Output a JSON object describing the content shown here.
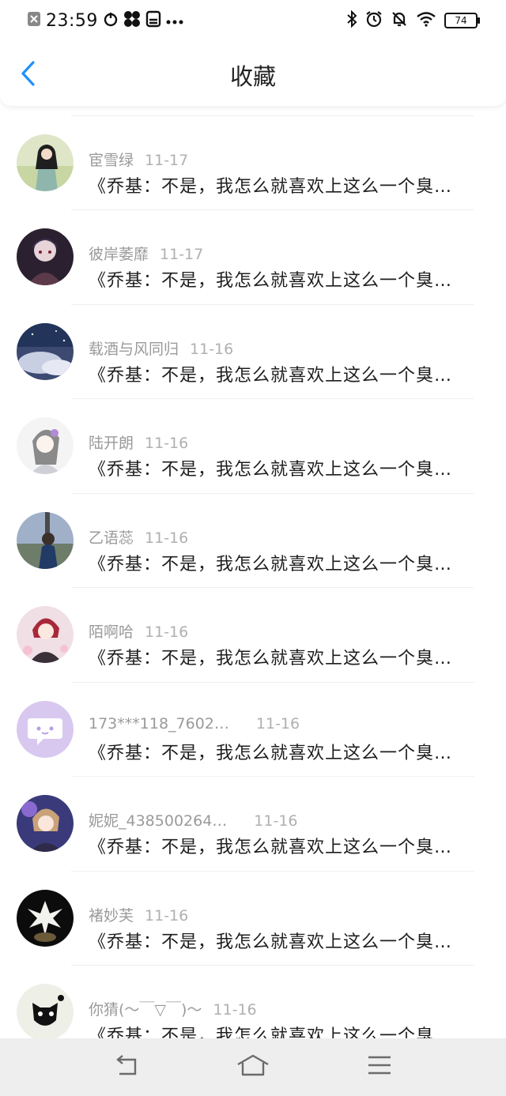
{
  "status_bar": {
    "time": "23:59",
    "battery": "74",
    "icons": [
      "close-box-icon",
      "power-sync-icon",
      "fan-icon",
      "sim-card-icon",
      "more-dots-icon",
      "bluetooth-icon",
      "alarm-icon",
      "mute-bell-icon",
      "wifi-icon",
      "battery-icon"
    ]
  },
  "header": {
    "title": "收藏",
    "back_icon": "chevron-left-icon"
  },
  "colors": {
    "accent": "#1e90ff",
    "text": "#1e1e1e",
    "meta": "#9a9a9a",
    "navbar": "#eeeeef"
  },
  "items": [
    {
      "name": "宦雪绿",
      "date": "11-17",
      "message": "《乔基：不是，我怎么就喜欢上这么一个臭…",
      "avatar": "avatar-photo"
    },
    {
      "name": "彼岸萎靡",
      "date": "11-17",
      "message": "《乔基：不是，我怎么就喜欢上这么一个臭…",
      "avatar": "avatar-photo"
    },
    {
      "name": "载酒与风同归",
      "date": "11-16",
      "message": "《乔基：不是，我怎么就喜欢上这么一个臭…",
      "avatar": "avatar-photo"
    },
    {
      "name": "陆开朗",
      "date": "11-16",
      "message": "《乔基：不是，我怎么就喜欢上这么一个臭…",
      "avatar": "avatar-photo"
    },
    {
      "name": "乙语蕊",
      "date": "11-16",
      "message": "《乔基：不是，我怎么就喜欢上这么一个臭…",
      "avatar": "avatar-photo"
    },
    {
      "name": "陌啊哈",
      "date": "11-16",
      "message": "《乔基：不是，我怎么就喜欢上这么一个臭…",
      "avatar": "avatar-photo"
    },
    {
      "name": "173***118_7602…",
      "date": "11-16",
      "message": "《乔基：不是，我怎么就喜欢上这么一个臭…",
      "avatar": "default-chat-avatar"
    },
    {
      "name": "妮妮_438500264…",
      "date": "11-16",
      "message": "《乔基：不是，我怎么就喜欢上这么一个臭…",
      "avatar": "avatar-photo"
    },
    {
      "name": "褚妙芙",
      "date": "11-16",
      "message": "《乔基：不是，我怎么就喜欢上这么一个臭…",
      "avatar": "avatar-photo"
    },
    {
      "name": "你猜(〜￣▽￣)〜",
      "date": "11-16",
      "message": "《乔基：不是，我怎么就喜欢上这么一个臭…",
      "avatar": "avatar-photo"
    }
  ],
  "nav_bar": {
    "icons": [
      "back-arrow-icon",
      "home-icon",
      "menu-icon"
    ]
  }
}
